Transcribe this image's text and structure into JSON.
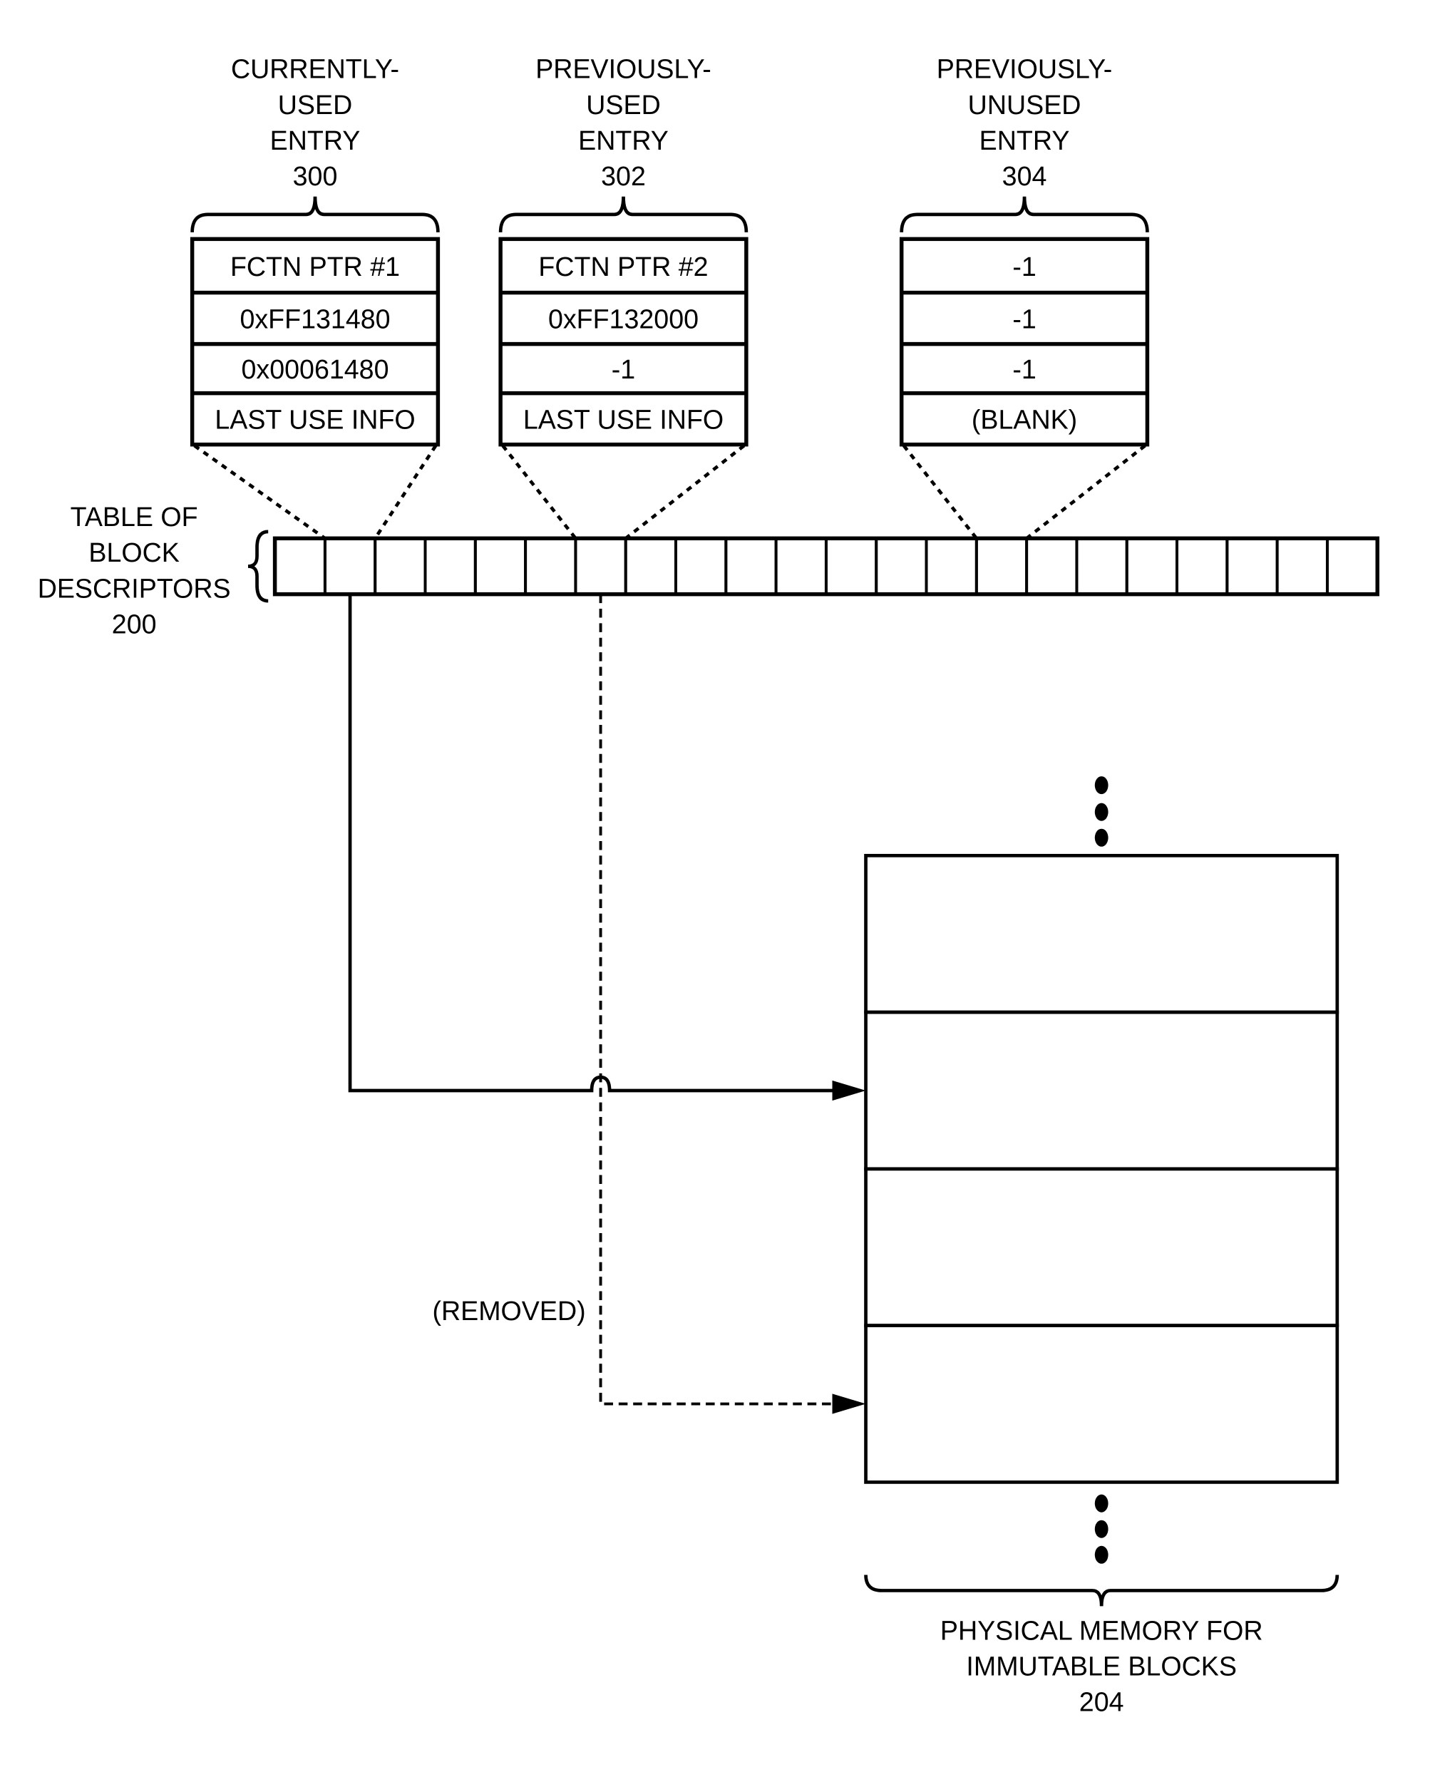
{
  "entries": [
    {
      "id": "currently-used-entry",
      "label_lines": [
        "CURRENTLY-",
        "USED",
        "ENTRY",
        "300"
      ],
      "fields": [
        "FCTN PTR #1",
        "0xFF131480",
        "0x00061480",
        "LAST USE INFO"
      ],
      "table_slot": 2
    },
    {
      "id": "previously-used-entry",
      "label_lines": [
        "PREVIOUSLY-",
        "USED",
        "ENTRY",
        "302"
      ],
      "fields": [
        "FCTN PTR #2",
        "0xFF132000",
        "-1",
        "LAST USE INFO"
      ],
      "table_slot": 7
    },
    {
      "id": "previously-unused-entry",
      "label_lines": [
        "PREVIOUSLY-",
        "UNUSED",
        "ENTRY",
        "304"
      ],
      "fields": [
        "-1",
        "-1",
        "-1",
        "(BLANK)"
      ],
      "table_slot": 15
    }
  ],
  "table": {
    "label_lines": [
      "TABLE OF",
      "BLOCK",
      "DESCRIPTORS",
      "200"
    ],
    "cell_count": 22
  },
  "links": [
    {
      "from_slot": 2,
      "to_block": 2,
      "style": "solid",
      "label": ""
    },
    {
      "from_slot": 7,
      "to_block": 4,
      "style": "dashed",
      "label": "(REMOVED)"
    }
  ],
  "memory": {
    "label_lines": [
      "PHYSICAL MEMORY FOR",
      "IMMUTABLE BLOCKS",
      "204"
    ],
    "block_count": 4,
    "ellipsis": "⋮"
  }
}
